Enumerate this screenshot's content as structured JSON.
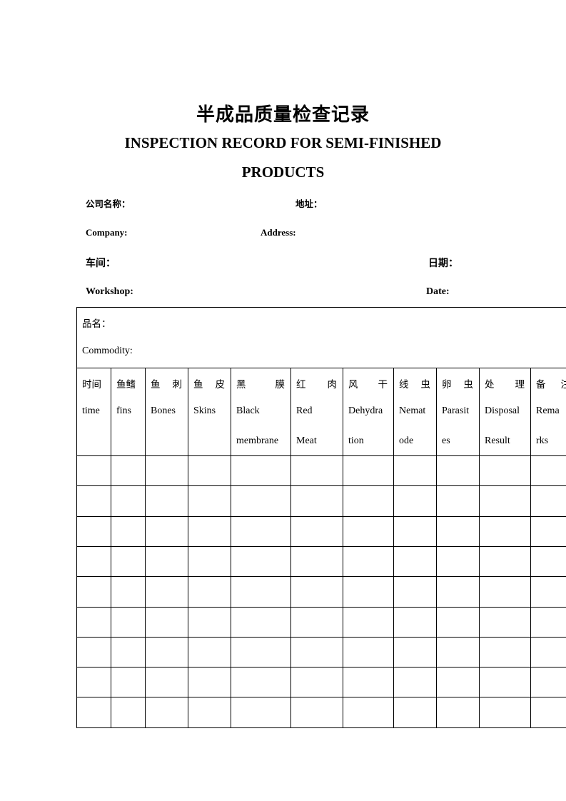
{
  "title": {
    "chinese": "半成品质量检查记录",
    "english_line1": "INSPECTION RECORD FOR SEMI-FINISHED",
    "english_line2": "PRODUCTS"
  },
  "fields": {
    "company_cn": "公司名称：",
    "address_cn": "地址：",
    "company_en": "Company:",
    "address_en": "Address:",
    "workshop_cn": "车间：",
    "date_cn": "日期：",
    "workshop_en": "Workshop:",
    "date_en": "Date:"
  },
  "table": {
    "commodity_cn": "品名：",
    "commodity_en": "Commodity:",
    "columns": [
      {
        "cn": [
          "时间"
        ],
        "en": [
          "time"
        ]
      },
      {
        "cn": [
          "鱼鳍"
        ],
        "en": [
          "fins"
        ]
      },
      {
        "cn": [
          "鱼",
          "刺"
        ],
        "en": [
          "Bones"
        ]
      },
      {
        "cn": [
          "鱼",
          "皮"
        ],
        "en": [
          "Skins"
        ]
      },
      {
        "cn": [
          "黑",
          "膜"
        ],
        "en": [
          "Black",
          "membrane"
        ]
      },
      {
        "cn": [
          "红",
          "肉"
        ],
        "en": [
          "Red",
          "Meat"
        ]
      },
      {
        "cn": [
          "风",
          "干"
        ],
        "en": [
          "Dehydra",
          "tion"
        ]
      },
      {
        "cn": [
          "线",
          "虫"
        ],
        "en": [
          "Nemat",
          "ode"
        ]
      },
      {
        "cn": [
          "卵",
          "虫"
        ],
        "en": [
          "Parasit",
          "es"
        ]
      },
      {
        "cn": [
          "处",
          "理"
        ],
        "en": [
          "Disposal",
          "Result"
        ]
      },
      {
        "cn": [
          "备",
          "注"
        ],
        "en": [
          "Rema",
          "rks"
        ]
      }
    ],
    "empty_rows": 9
  }
}
